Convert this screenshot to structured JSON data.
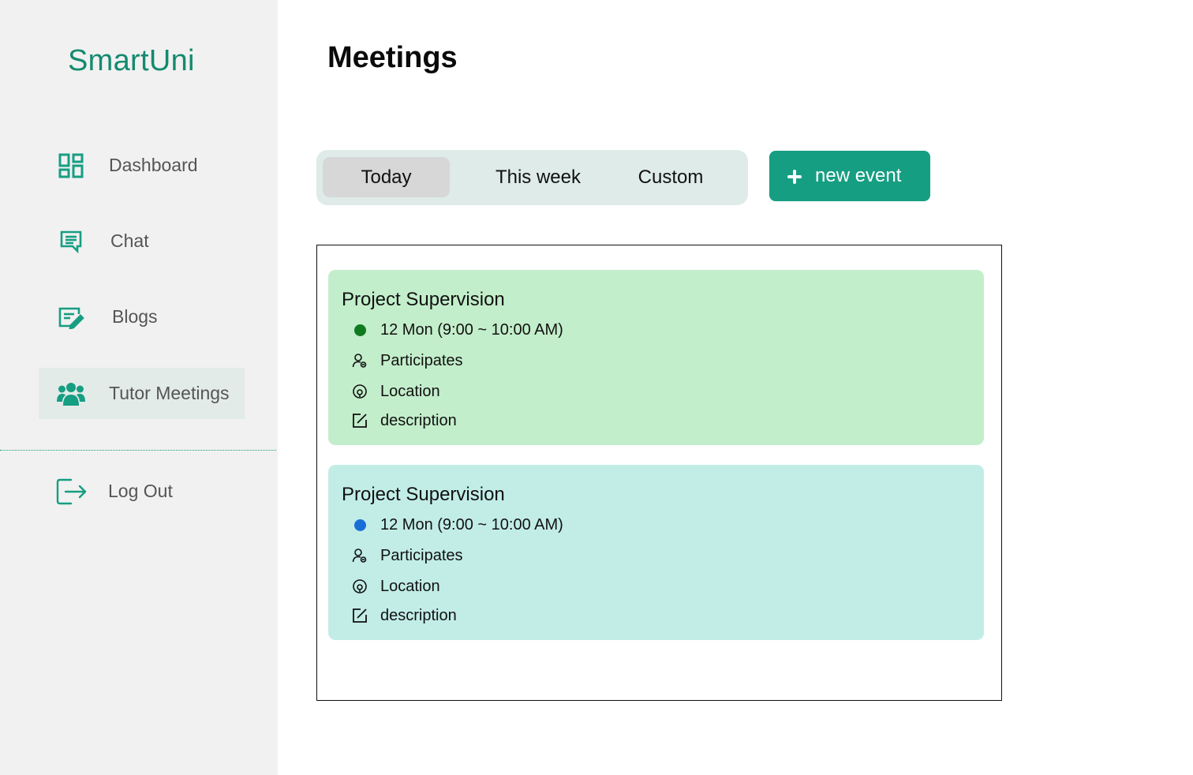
{
  "app": {
    "brand": "SmartUni"
  },
  "sidebar": {
    "items": [
      {
        "label": "Dashboard",
        "icon": "dashboard-icon",
        "active": false
      },
      {
        "label": "Chat",
        "icon": "chat-icon",
        "active": false
      },
      {
        "label": "Blogs",
        "icon": "blog-edit-icon",
        "active": false
      },
      {
        "label": "Tutor Meetings",
        "icon": "users-icon",
        "active": true
      }
    ],
    "logout": {
      "label": "Log Out",
      "icon": "logout-icon"
    }
  },
  "main": {
    "title": "Meetings",
    "tabs": [
      {
        "label": "Today",
        "active": true
      },
      {
        "label": "This week",
        "active": false
      },
      {
        "label": "Custom",
        "active": false
      }
    ],
    "new_event_label": "new event",
    "events": [
      {
        "title": "Project Supervision",
        "time": "12 Mon (9:00 ~ 10:00 AM)",
        "participants": "Participates",
        "location": "Location",
        "description": "description",
        "card_color": "#c3eecb",
        "dot_color": "#0f7a1e"
      },
      {
        "title": "Project Supervision",
        "time": "12 Mon (9:00 ~ 10:00 AM)",
        "participants": "Participates",
        "location": "Location",
        "description": "description",
        "card_color": "#c2ede7",
        "dot_color": "#1a6fd6"
      }
    ]
  },
  "colors": {
    "accent": "#169e82",
    "brand_text": "#148a6e",
    "sidebar_bg": "#f1f1f1",
    "active_item_bg": "#e3ebe9"
  }
}
